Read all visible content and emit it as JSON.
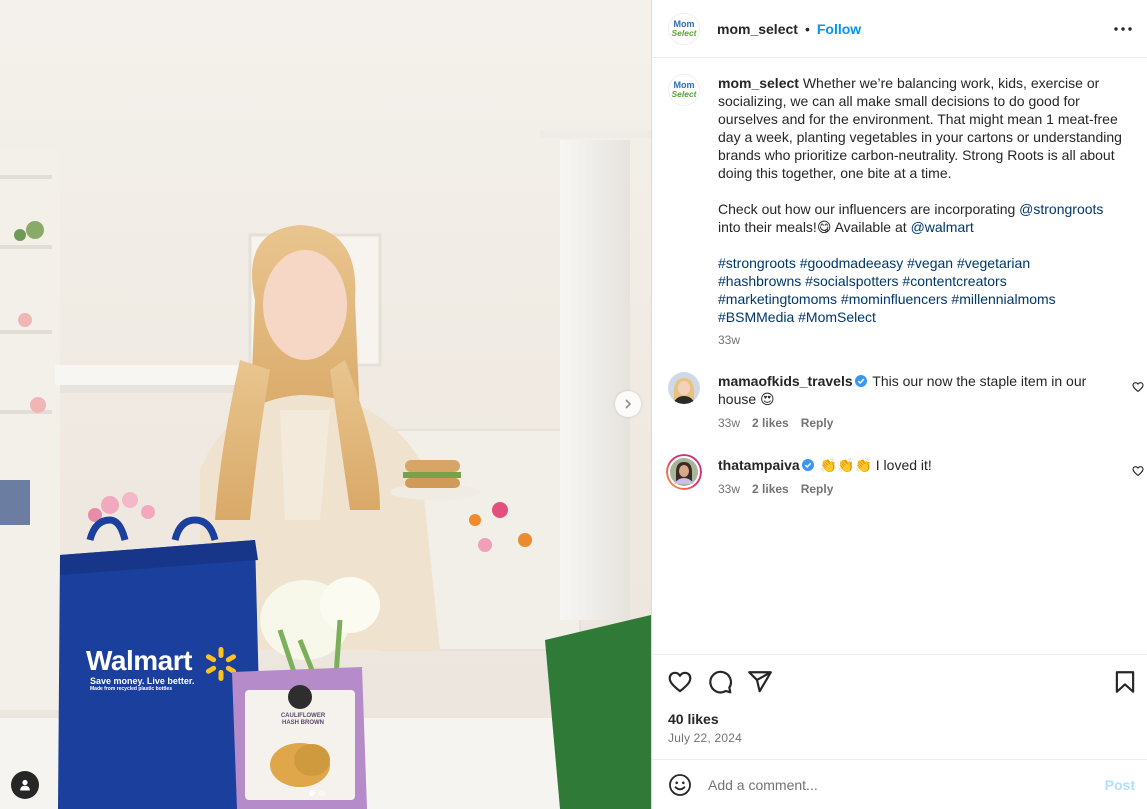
{
  "post": {
    "username": "mom_select",
    "follow_label": "Follow",
    "separator": "•",
    "avatar_logo": {
      "line1": "Mom",
      "line2": "Select"
    },
    "caption": {
      "p1": "Whether we’re balancing work, kids, exercise or socializing, we can all make small decisions to do good for ourselves and for the environment. That might mean 1 meat-free day a week, planting vegetables in your cartons or understanding brands who prioritize carbon-neutrality. Strong Roots is all about doing this together, one bite at a time.",
      "p2_a": "Check out how our influencers are incorporating ",
      "p2_mention1": "@strongroots",
      "p2_b": " into their meals!😋 Available at ",
      "p2_mention2": "@walmart",
      "hashtags": "#strongroots #goodmadeeasy #vegan #vegetarian #hashbrowns #socialspotters #contentcreators #marketingtomoms #mominfluencers #millennialmoms #BSMMedia #MomSelect",
      "time": "33w"
    },
    "comments": [
      {
        "username": "mamaofkids_travels",
        "text": "This our now the staple item in our house 😍",
        "time": "33w",
        "likes": "2 likes",
        "reply": "Reply"
      },
      {
        "username": "thatampaiva",
        "text": "👏👏👏 I loved it!",
        "time": "33w",
        "likes": "2 likes",
        "reply": "Reply"
      }
    ],
    "likes": "40 likes",
    "date": "July 22, 2024",
    "add_comment": {
      "placeholder": "Add a comment...",
      "post_label": "Post"
    },
    "photo": {
      "bag_brand": "Walmart",
      "bag_tagline": "Save money. Live better.",
      "bag_subline": "Made from recycled plastic bottles",
      "package_line1": "CAULIFLOWER",
      "package_line2": "HASH BROWN"
    },
    "colors": {
      "link": "#00376b",
      "follow": "#0095f6",
      "walmart_blue": "#1b3f9c",
      "walmart_yellow": "#ffc220"
    }
  }
}
